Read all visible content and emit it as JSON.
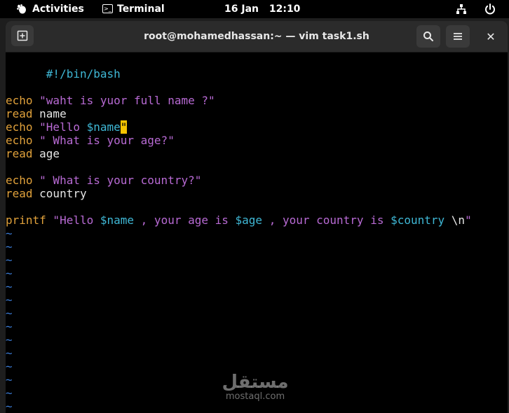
{
  "topbar": {
    "activities": "Activities",
    "app_name": "Terminal",
    "date": "16 Jan",
    "time": "12:10",
    "icons": [
      "gnome-icon",
      "terminal-icon",
      "network-icon",
      "power-icon"
    ]
  },
  "window": {
    "title": "root@mohamedhassan:~ — vim task1.sh",
    "close_glyph": "✕"
  },
  "editor": {
    "shebang": "#!/bin/bash",
    "l1": {
      "cmd": "echo",
      "arg": " \"waht is yuor full name ?\""
    },
    "l2": {
      "cmd": "read",
      "arg": " name"
    },
    "l3": {
      "cmd": "echo",
      "arg1": " \"Hello ",
      "var": "$name",
      "cursor": "\""
    },
    "l4": {
      "cmd": "echo",
      "arg": " \" What is your age?\""
    },
    "l5": {
      "cmd": "read",
      "arg": " age"
    },
    "l6": {
      "cmd": "echo",
      "arg": " \" What is your country?\""
    },
    "l7": {
      "cmd": "read",
      "arg": " country"
    },
    "l8": {
      "cmd": "printf",
      "s1": " \"Hello ",
      "v1": "$name",
      "s2": " , your age is ",
      "v2": "$age",
      "s3": " , your country is ",
      "v3": "$country",
      "esc": " \\n",
      "s4": "\""
    },
    "empty_marker": "~",
    "empty_line_count": 14
  },
  "watermark": {
    "arabic": "مستقل",
    "latin": "mostaql.com"
  },
  "colors": {
    "keyword": "#e0a13b",
    "string": "#b86ad4",
    "variable": "#3fb8d6",
    "tilde": "#3a7bd5",
    "cursor": "#f5c400"
  }
}
